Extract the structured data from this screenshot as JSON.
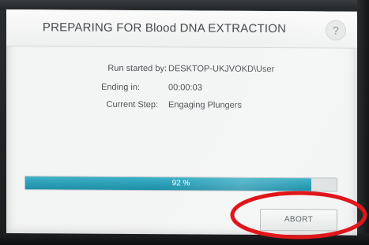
{
  "dialog": {
    "title": "PREPARING FOR Blood DNA EXTRACTION",
    "help_label": "?"
  },
  "info": {
    "run_started_label": "Run started by:",
    "run_started_value": "DESKTOP-UKJVOKD\\User",
    "ending_in_label": "Ending in:",
    "ending_in_value": "00:00:03",
    "current_step_label": "Current Step:",
    "current_step_value": "Engaging Plungers"
  },
  "progress": {
    "percent": 92,
    "label": "92 %"
  },
  "abort_label": "ABORT",
  "colors": {
    "progress_fill": "#1e8fa8",
    "annotation": "#e0161b",
    "screen_background": "#f3f4f4"
  }
}
